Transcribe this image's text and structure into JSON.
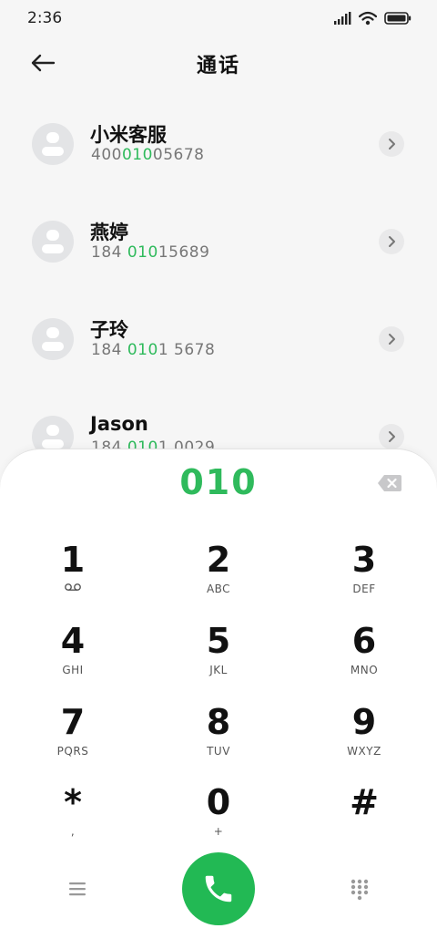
{
  "status": {
    "time": "2:36"
  },
  "header": {
    "title": "通话"
  },
  "contacts": [
    {
      "name": "小米客服",
      "num_pre": "400",
      "num_hl": "010",
      "num_post": "05678"
    },
    {
      "name": "燕婷",
      "num_pre": "184 ",
      "num_hl": "010",
      "num_post": "15689"
    },
    {
      "name": "子玲",
      "num_pre": "184 ",
      "num_hl": "010",
      "num_post": "1 5678"
    },
    {
      "name": "Jason",
      "num_pre": "184 ",
      "num_hl": "010",
      "num_post": "1 0029"
    }
  ],
  "dialpad": {
    "typed": "010",
    "keys": [
      {
        "digit": "1",
        "letters": ""
      },
      {
        "digit": "2",
        "letters": "ABC"
      },
      {
        "digit": "3",
        "letters": "DEF"
      },
      {
        "digit": "4",
        "letters": "GHI"
      },
      {
        "digit": "5",
        "letters": "JKL"
      },
      {
        "digit": "6",
        "letters": "MNO"
      },
      {
        "digit": "7",
        "letters": "PQRS"
      },
      {
        "digit": "8",
        "letters": "TUV"
      },
      {
        "digit": "9",
        "letters": "WXYZ"
      },
      {
        "digit": "*",
        "letters": ","
      },
      {
        "digit": "0",
        "letters": "+"
      },
      {
        "digit": "#",
        "letters": ""
      }
    ]
  },
  "colors": {
    "accent": "#2fba5c",
    "call_button": "#22b954"
  }
}
